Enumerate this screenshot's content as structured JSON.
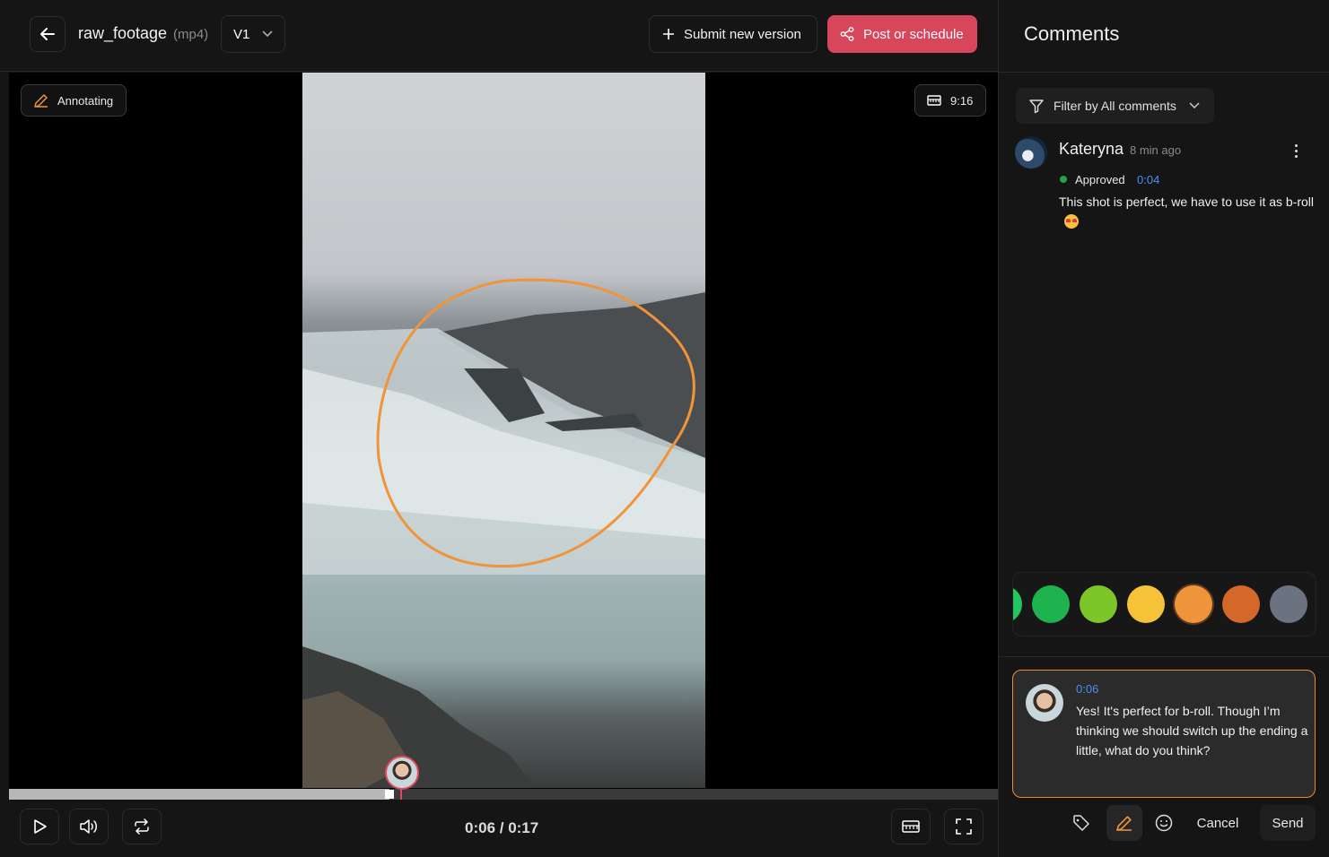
{
  "header": {
    "file_title": "raw_footage",
    "file_ext": "(mp4)",
    "version": "V1",
    "submit_label": "Submit new version",
    "post_label": "Post or schedule"
  },
  "video": {
    "annotating_label": "Annotating",
    "aspect_ratio": "9:16",
    "annotation_color": "#f0943c",
    "progress_fraction": 0.385,
    "time_display": "0:06 / 0:17"
  },
  "comments_panel": {
    "title": "Comments",
    "filter_label": "Filter by All comments",
    "comments": [
      {
        "author": "Kateryna",
        "time_ago": "8 min ago",
        "status": "Approved",
        "timestamp": "0:04",
        "text": "This shot is perfect, we have to use it as b-roll"
      }
    ],
    "colors": [
      "#22c55e",
      "#1fb350",
      "#7cc62a",
      "#f5c238",
      "#f0943c",
      "#d4672a",
      "#6b7280"
    ],
    "selected_color": "#f0943c",
    "reply": {
      "timestamp": "0:06",
      "text": "Yes! It's perfect for b-roll. Though I’m thinking we should switch up the ending a little, what do you think?"
    },
    "cancel_label": "Cancel",
    "send_label": "Send"
  }
}
